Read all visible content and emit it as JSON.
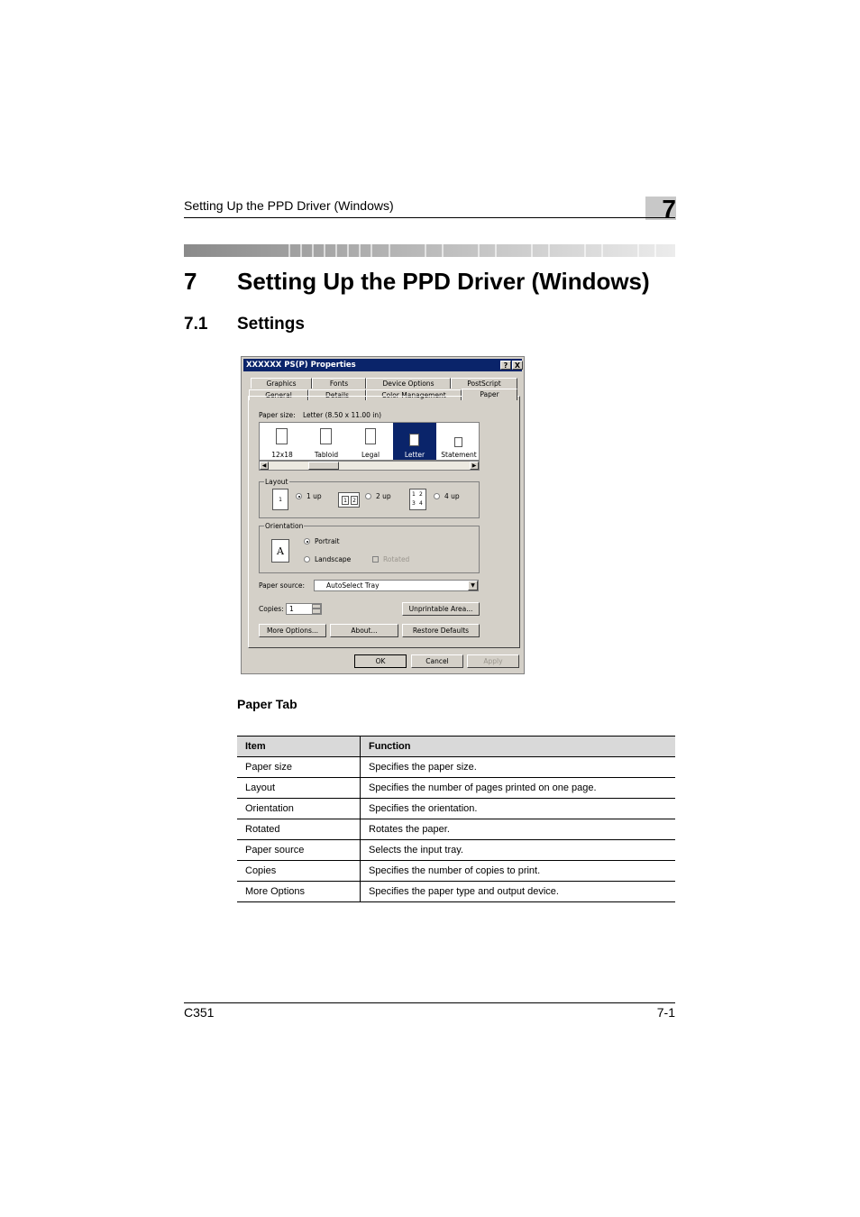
{
  "header": {
    "running_title": "Setting Up the PPD Driver (Windows)",
    "chapter_number": "7"
  },
  "heading1": {
    "number": "7",
    "title": "Setting Up the PPD Driver (Windows)"
  },
  "heading2": {
    "number": "7.1",
    "title": "Settings"
  },
  "dialog": {
    "title": "XXXXXX PS(P) Properties",
    "help_btn": "?",
    "close_btn": "X",
    "tabs_back": [
      "Graphics",
      "Fonts",
      "Device Options",
      "PostScript"
    ],
    "tabs_front": [
      "General",
      "Details",
      "Color Management",
      "Paper"
    ],
    "paper_size_label": "Paper size:",
    "paper_size_value": "Letter (8.50 x 11.00 in)",
    "paper_items": [
      "12x18",
      "Tabloid",
      "Legal",
      "Letter",
      "Statement"
    ],
    "selected_paper": "Letter",
    "layout_group": "Layout",
    "layout_options": [
      "1 up",
      "2 up",
      "4 up"
    ],
    "orientation_group": "Orientation",
    "orientation_icon": "A",
    "portrait": "Portrait",
    "landscape": "Landscape",
    "rotated": "Rotated",
    "paper_source_label": "Paper source:",
    "paper_source_value": "AutoSelect Tray",
    "copies_label": "Copies:",
    "copies_value": "1",
    "unprintable_btn": "Unprintable Area...",
    "more_options_btn": "More Options...",
    "about_btn": "About...",
    "restore_btn": "Restore Defaults",
    "ok_btn": "OK",
    "cancel_btn": "Cancel",
    "apply_btn": "Apply",
    "page_icon_1": "1",
    "page_icon_2": [
      "1",
      "2"
    ],
    "page_icon_4": [
      "1",
      "2",
      "3",
      "4"
    ]
  },
  "caption": "Paper Tab",
  "table": {
    "headers": [
      "Item",
      "Function"
    ],
    "rows": [
      [
        "Paper size",
        "Specifies the paper size."
      ],
      [
        "Layout",
        "Specifies the number of pages printed on one page."
      ],
      [
        "Orientation",
        "Specifies the orientation."
      ],
      [
        "Rotated",
        "Rotates the paper."
      ],
      [
        "Paper source",
        "Selects the input tray."
      ],
      [
        "Copies",
        "Specifies the number of copies to print."
      ],
      [
        "More Options",
        "Specifies the paper type and output device."
      ]
    ]
  },
  "footer": {
    "left": "C351",
    "right": "7-1"
  }
}
